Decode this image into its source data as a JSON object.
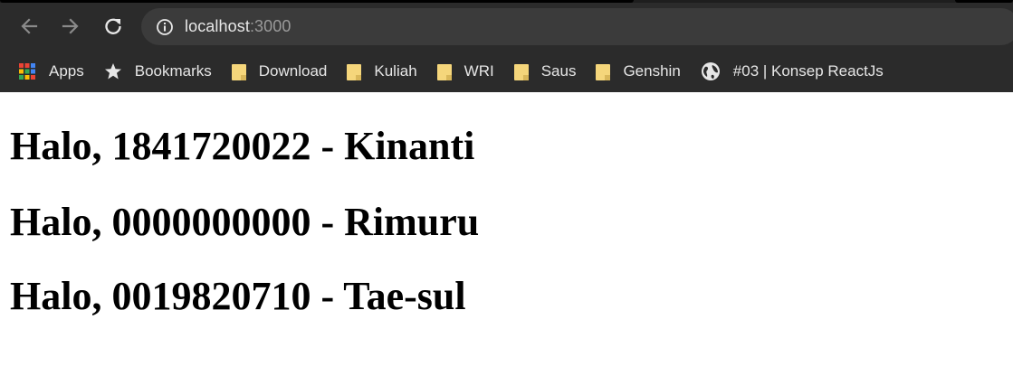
{
  "browser": {
    "address_bar": {
      "host": "localhost",
      "port": ":3000"
    },
    "bookmarks": [
      {
        "label": "Apps",
        "icon": "apps-grid-icon"
      },
      {
        "label": "Bookmarks",
        "icon": "star-icon"
      },
      {
        "label": "Download",
        "icon": "folder-icon"
      },
      {
        "label": "Kuliah",
        "icon": "folder-icon"
      },
      {
        "label": "WRI",
        "icon": "folder-icon"
      },
      {
        "label": "Saus",
        "icon": "folder-icon"
      },
      {
        "label": "Genshin",
        "icon": "folder-icon"
      },
      {
        "label": "#03 | Konsep ReactJs",
        "icon": "globe-icon"
      }
    ]
  },
  "page": {
    "greetings": [
      "Halo, 1841720022 - Kinanti",
      "Halo, 0000000000 - Rimuru",
      "Halo, 0019820710 - Tae-sul"
    ]
  },
  "colors": {
    "toolbar_bg": "#2b2b2b",
    "omnibox_bg": "#3b3b3b",
    "folder": "#f5d67b"
  }
}
